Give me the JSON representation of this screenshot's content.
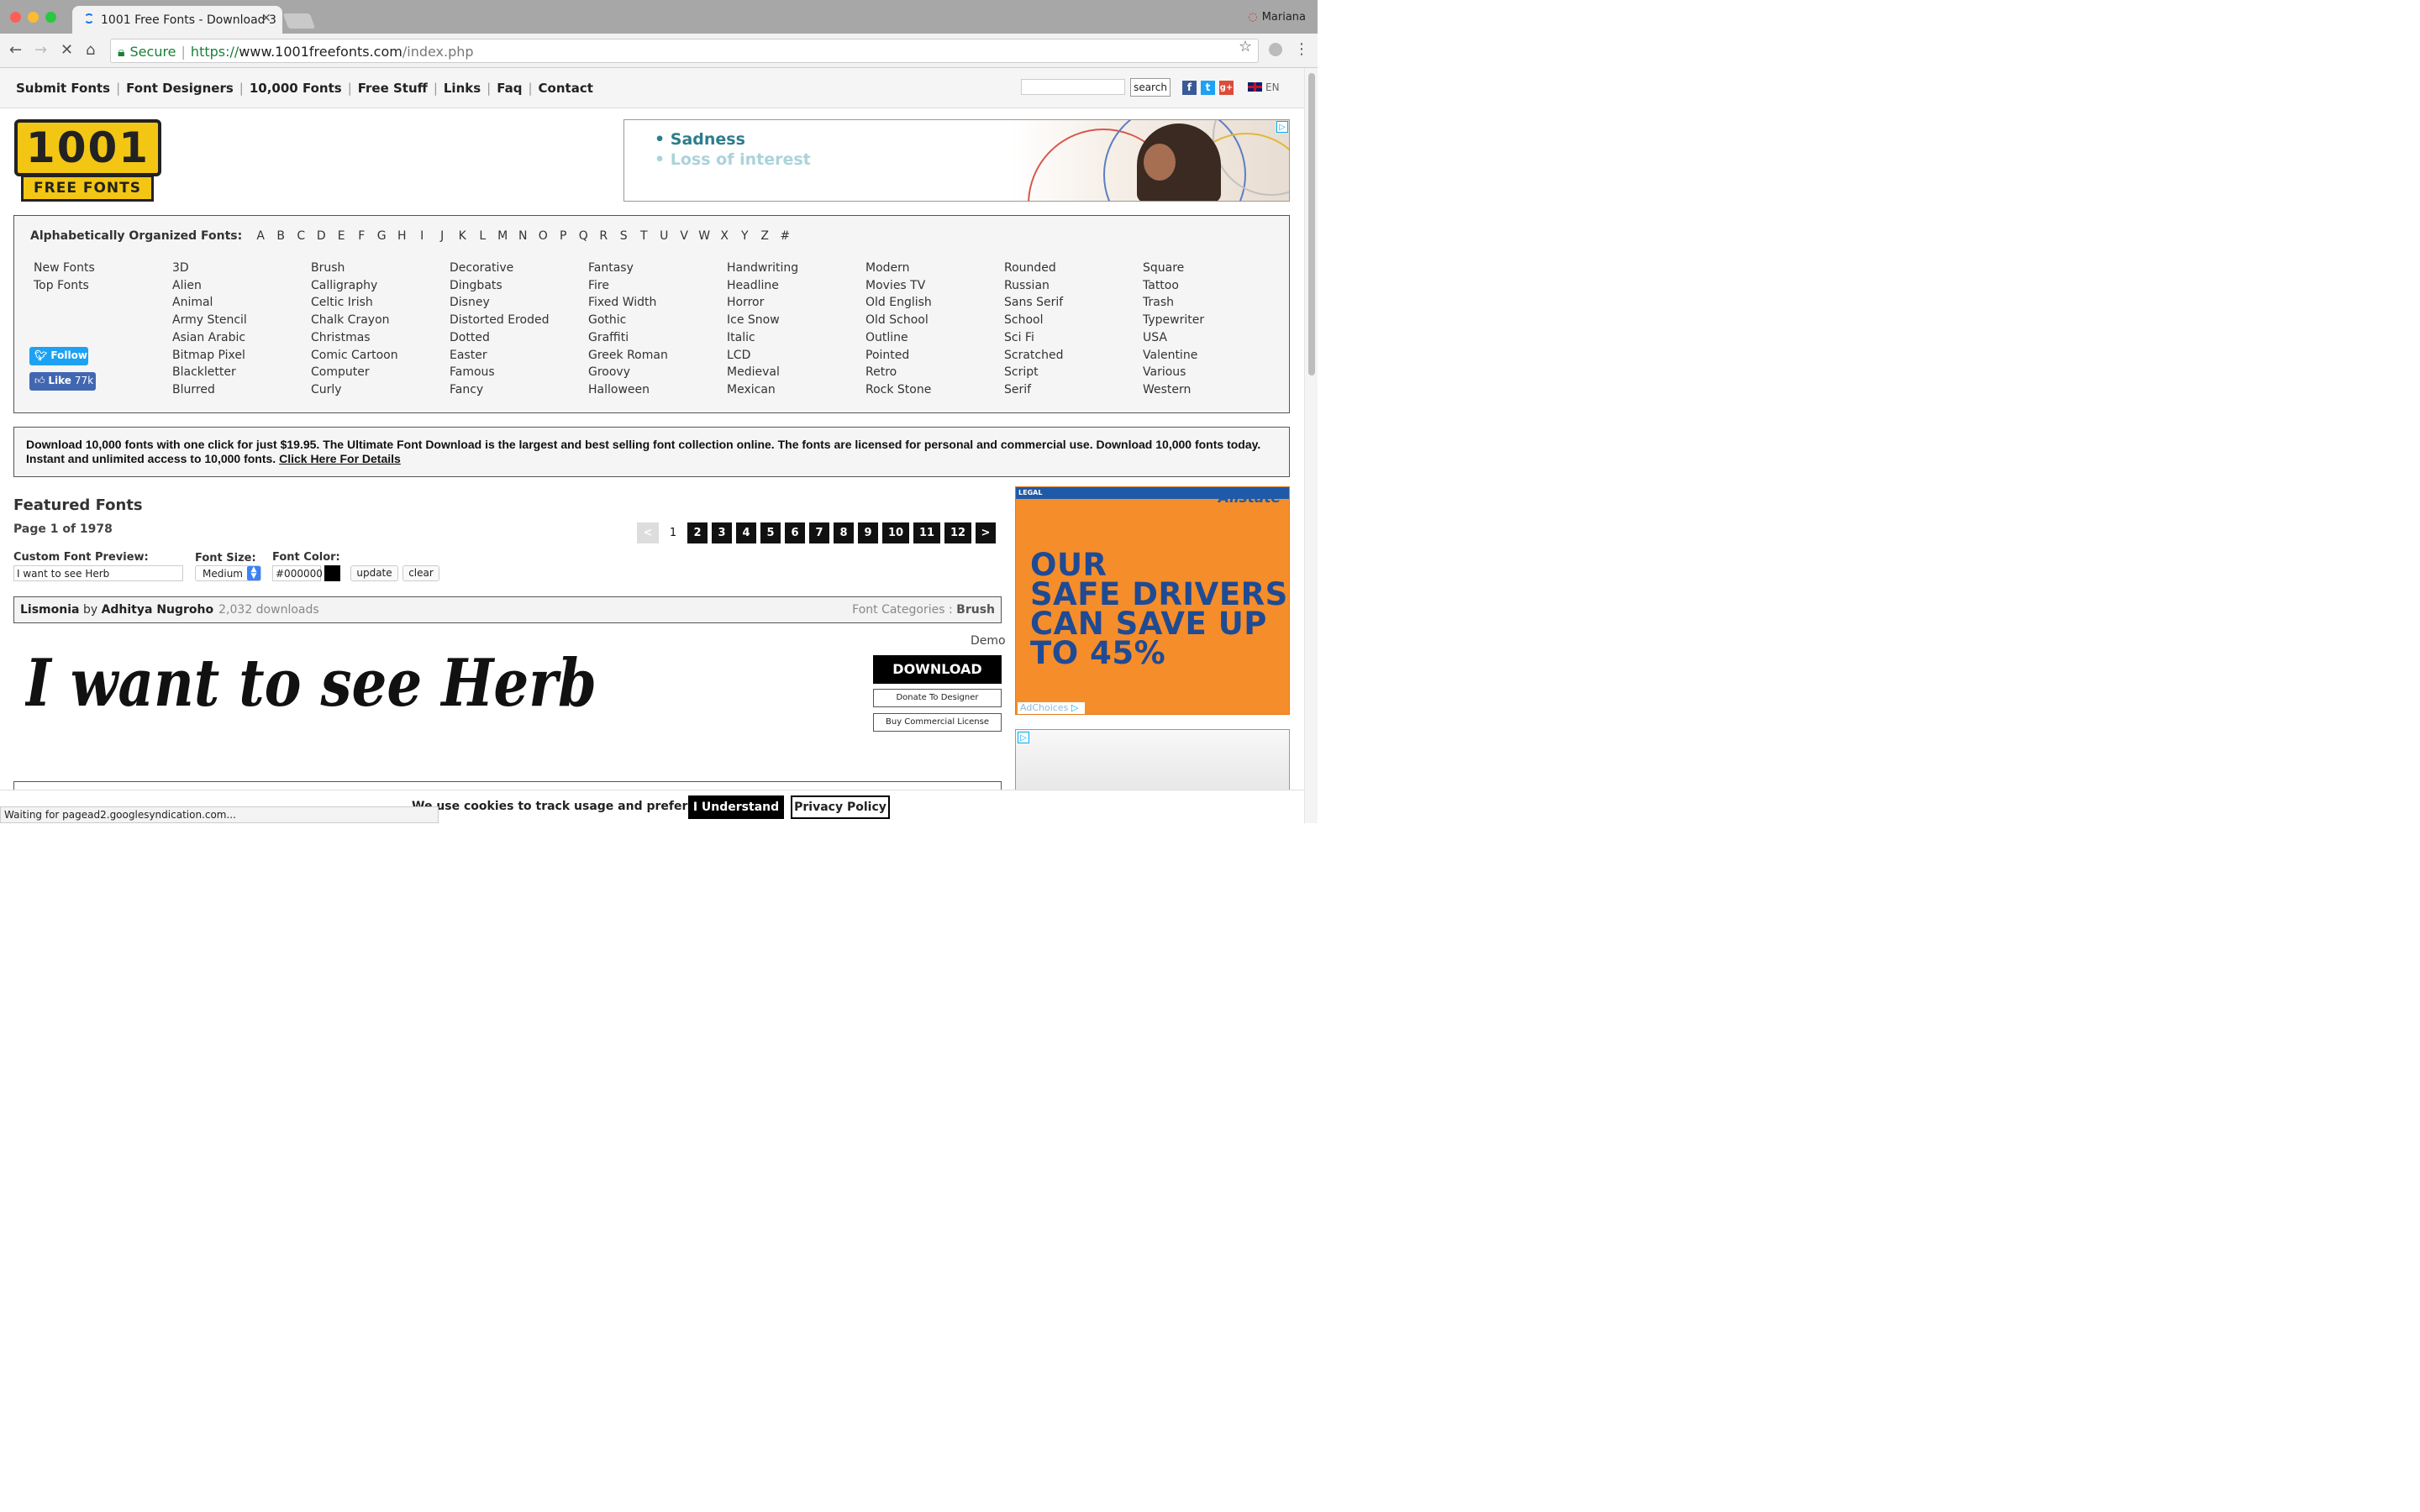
{
  "browser": {
    "tab_title": "1001 Free Fonts - Download 3",
    "user": "Mariana",
    "secure_label": "Secure",
    "url_scheme": "https://",
    "url_host": "www.1001freefonts.com",
    "url_path": "/index.php"
  },
  "nav": {
    "links": [
      "Submit Fonts",
      "Font Designers",
      "10,000 Fonts",
      "Free Stuff",
      "Links",
      "Faq",
      "Contact"
    ],
    "search_button": "search",
    "lang": "EN"
  },
  "logo": {
    "top": "1001",
    "bottom": "FREE FONTS"
  },
  "ad_top": {
    "line1": "• Sadness",
    "line2": "• Loss of interest"
  },
  "alphabet": {
    "label": "Alphabetically Organized Fonts:",
    "letters": [
      "A",
      "B",
      "C",
      "D",
      "E",
      "F",
      "G",
      "H",
      "I",
      "J",
      "K",
      "L",
      "M",
      "N",
      "O",
      "P",
      "Q",
      "R",
      "S",
      "T",
      "U",
      "V",
      "W",
      "X",
      "Y",
      "Z",
      "#"
    ]
  },
  "categories": [
    [
      "New Fonts",
      "Top Fonts"
    ],
    [
      "3D",
      "Alien",
      "Animal",
      "Army Stencil",
      "Asian Arabic",
      "Bitmap Pixel",
      "Blackletter",
      "Blurred"
    ],
    [
      "Brush",
      "Calligraphy",
      "Celtic Irish",
      "Chalk Crayon",
      "Christmas",
      "Comic Cartoon",
      "Computer",
      "Curly"
    ],
    [
      "Decorative",
      "Dingbats",
      "Disney",
      "Distorted Eroded",
      "Dotted",
      "Easter",
      "Famous",
      "Fancy"
    ],
    [
      "Fantasy",
      "Fire",
      "Fixed Width",
      "Gothic",
      "Graffiti",
      "Greek Roman",
      "Groovy",
      "Halloween"
    ],
    [
      "Handwriting",
      "Headline",
      "Horror",
      "Ice Snow",
      "Italic",
      "LCD",
      "Medieval",
      "Mexican"
    ],
    [
      "Modern",
      "Movies TV",
      "Old English",
      "Old School",
      "Outline",
      "Pointed",
      "Retro",
      "Rock Stone"
    ],
    [
      "Rounded",
      "Russian",
      "Sans Serif",
      "School",
      "Sci Fi",
      "Scratched",
      "Script",
      "Serif"
    ],
    [
      "Square",
      "Tattoo",
      "Trash",
      "Typewriter",
      "USA",
      "Valentine",
      "Various",
      "Western"
    ]
  ],
  "social": {
    "follow": "Follow",
    "like": "Like",
    "like_count": "77k"
  },
  "promo": {
    "text": "Download 10,000 fonts with one click for just $19.95. The Ultimate Font Download is the largest and best selling font collection online. The fonts are licensed for personal and commercial use. Download 10,000 fonts today. Instant and unlimited access to 10,000 fonts.",
    "link": "Click Here For Details"
  },
  "featured": {
    "title": "Featured Fonts",
    "page_info": "Page 1 of 1978",
    "pagination": [
      "<",
      "1",
      "2",
      "3",
      "4",
      "5",
      "6",
      "7",
      "8",
      "9",
      "10",
      "11",
      "12",
      ">"
    ],
    "current_page": "1"
  },
  "controls": {
    "preview_label": "Custom Font Preview:",
    "preview_value": "I want to see Herb",
    "size_label": "Font Size:",
    "size_value": "Medium",
    "color_label": "Font Color:",
    "color_value": "#000000",
    "update": "update",
    "clear": "clear"
  },
  "font": {
    "name": "Lismonia",
    "by": "by",
    "designer": "Adhitya Nugroho",
    "downloads": "2,032 downloads",
    "categories_label": "Font Categories :",
    "category": "Brush",
    "license": "Demo",
    "download": "DOWNLOAD",
    "donate": "Donate To Designer",
    "buy": "Buy Commercial License",
    "preview_text": "I want to see Herb"
  },
  "ad_right": {
    "legal": "LEGAL",
    "brand": "Allstate",
    "headline": "OUR SAFE DRIVERS CAN SAVE UP TO 45%",
    "adchoices": "AdChoices"
  },
  "cookie": {
    "text": "We use cookies to track usage and preferences.",
    "accept": "I Understand",
    "policy": "Privacy Policy"
  },
  "status_bar": "Waiting for pagead2.googlesyndication.com...",
  "colors": {
    "accent": "#000000",
    "ad_orange": "#f58d2a",
    "ad_blue": "#1f4a94",
    "logo_yellow": "#f3c614"
  }
}
